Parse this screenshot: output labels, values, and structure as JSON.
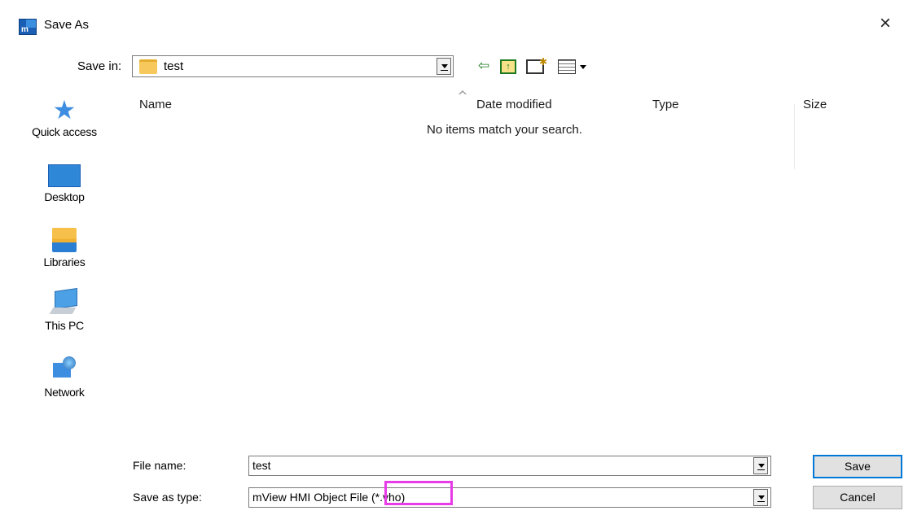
{
  "window": {
    "title": "Save As",
    "app_icon_letter": "m",
    "close_label": "×"
  },
  "toolbar": {
    "save_in_label": "Save in:",
    "save_in_value": "test"
  },
  "places": [
    {
      "label": "Quick access",
      "icon": "quick-access-star-icon"
    },
    {
      "label": "Desktop",
      "icon": "desktop-icon"
    },
    {
      "label": "Libraries",
      "icon": "libraries-icon"
    },
    {
      "label": "This PC",
      "icon": "this-pc-icon"
    },
    {
      "label": "Network",
      "icon": "network-icon"
    }
  ],
  "filelist": {
    "columns": [
      "Name",
      "Date modified",
      "Type",
      "Size"
    ],
    "empty_message": "No items match your search."
  },
  "form": {
    "file_name_label": "File name:",
    "file_name_value": "test",
    "save_type_label": "Save as type:",
    "save_type_value": "mView HMI Object File (*.vho)"
  },
  "buttons": {
    "save": "Save",
    "cancel": "Cancel"
  },
  "colors": {
    "highlight": "#e83be8",
    "accent": "#0078d7"
  }
}
